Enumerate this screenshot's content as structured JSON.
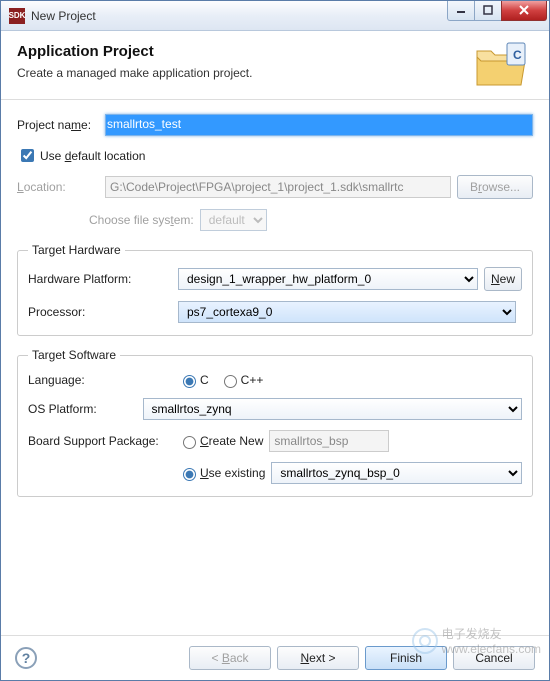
{
  "window": {
    "title": "New Project"
  },
  "header": {
    "title": "Application Project",
    "subtitle": "Create a managed make application project."
  },
  "form": {
    "project_name_label": "Project name:",
    "project_name_value": "smallrtos_test",
    "use_default_label": "Use default location",
    "use_default_checked": true,
    "location_label": "Location:",
    "location_value": "G:\\Code\\Project\\FPGA\\project_1\\project_1.sdk\\smallrtc",
    "browse_label": "Browse...",
    "choose_fs_label": "Choose file system:",
    "fs_value": "default"
  },
  "hw": {
    "legend": "Target Hardware",
    "platform_label": "Hardware Platform:",
    "platform_value": "design_1_wrapper_hw_platform_0",
    "new_label": "New",
    "processor_label": "Processor:",
    "processor_value": "ps7_cortexa9_0"
  },
  "sw": {
    "legend": "Target Software",
    "language_label": "Language:",
    "lang_c": "C",
    "lang_cpp": "C++",
    "lang_selected": "C",
    "os_label": "OS Platform:",
    "os_value": "smallrtos_zynq",
    "bsp_label": "Board Support Package:",
    "create_new_label": "Create New",
    "create_new_value": "smallrtos_bsp",
    "use_existing_label": "Use existing",
    "use_existing_value": "smallrtos_zynq_bsp_0",
    "bsp_selected": "existing"
  },
  "footer": {
    "back": "< Back",
    "next": "Next >",
    "finish": "Finish",
    "cancel": "Cancel"
  },
  "watermark": {
    "text": "www.elecfans.com",
    "brand": "电子发烧友"
  }
}
